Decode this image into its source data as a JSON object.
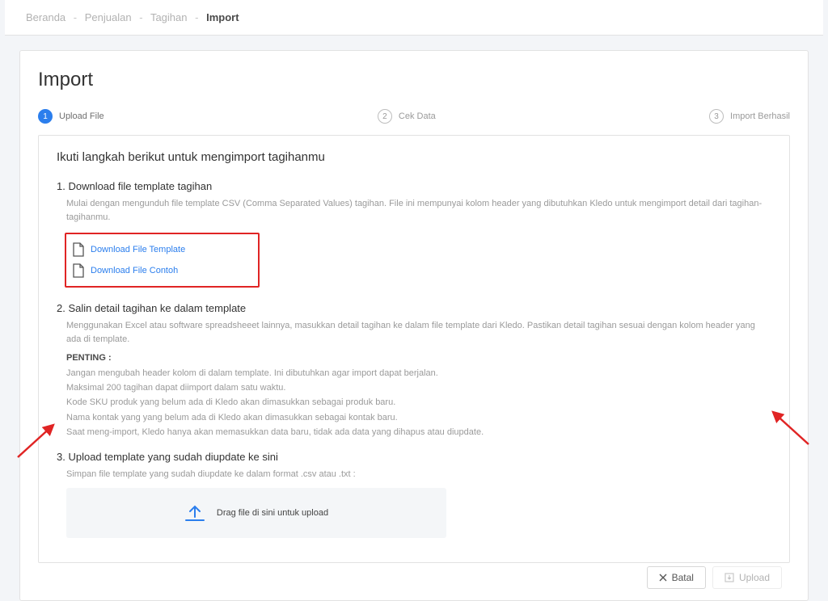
{
  "breadcrumb": {
    "items": [
      "Beranda",
      "Penjualan",
      "Tagihan"
    ],
    "current": "Import"
  },
  "page": {
    "title": "Import"
  },
  "steps": {
    "s1": {
      "num": "1",
      "label": "Upload File"
    },
    "s2": {
      "num": "2",
      "label": "Cek Data"
    },
    "s3": {
      "num": "3",
      "label": "Import Berhasil"
    }
  },
  "content": {
    "instruction": "Ikuti langkah berikut untuk mengimport tagihanmu",
    "s1_head": "1. Download file template tagihan",
    "s1_text": "Mulai dengan mengunduh file template CSV (Comma Separated Values) tagihan. File ini mempunyai kolom header yang dibutuhkan Kledo untuk mengimport detail dari tagihan-tagihanmu.",
    "dl_template": "Download File Template",
    "dl_contoh": "Download File Contoh",
    "s2_head": "2. Salin detail tagihan ke dalam template",
    "s2_text": "Menggunakan Excel atau software spreadsheeet lainnya, masukkan detail tagihan ke dalam file template dari Kledo. Pastikan detail tagihan sesuai dengan kolom header yang ada di template.",
    "penting_label": "PENTING :",
    "penting_1": "Jangan mengubah header kolom di dalam template. Ini dibutuhkan agar import dapat berjalan.",
    "penting_2": "Maksimal 200 tagihan dapat diimport dalam satu waktu.",
    "penting_3": "Kode SKU produk yang belum ada di Kledo akan dimasukkan sebagai produk baru.",
    "penting_4": "Nama kontak yang yang belum ada di Kledo akan dimasukkan sebagai kontak baru.",
    "penting_5": "Saat meng-import, Kledo hanya akan memasukkan data baru, tidak ada data yang dihapus atau diupdate.",
    "s3_head": "3. Upload template yang sudah diupdate ke sini",
    "s3_text": "Simpan file template yang sudah diupdate ke dalam format .csv atau .txt :",
    "drag_text": "Drag file di sini untuk upload"
  },
  "buttons": {
    "cancel": "Batal",
    "upload": "Upload"
  },
  "annotation": {
    "highlight_box": true,
    "arrow_left": true,
    "arrow_right": true,
    "color": "#e02424"
  }
}
